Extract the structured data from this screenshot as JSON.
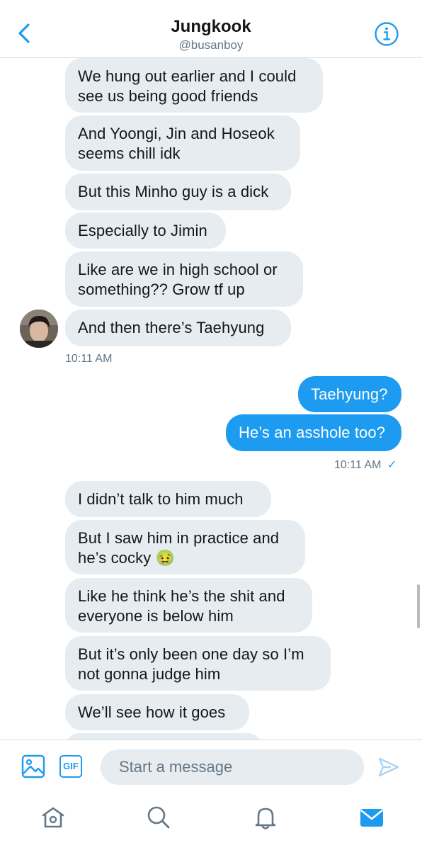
{
  "header": {
    "title": "Jungkook",
    "handle": "@busanboy",
    "back_icon": "chevron-left-icon",
    "info_icon": "info-icon"
  },
  "messages": {
    "group1": [
      {
        "lines": [
          "We hung out earlier and I could",
          "see us being good friends"
        ]
      },
      {
        "lines": [
          "And Yoongi, Jin and Hoseok",
          "seems chill idk"
        ]
      },
      {
        "lines": [
          "But this Minho guy is a dick"
        ]
      },
      {
        "lines": [
          "Especially to Jimin"
        ]
      },
      {
        "lines": [
          "Like are we in high school or",
          "something?? Grow tf up"
        ]
      },
      {
        "lines": [
          "And then there’s Taehyung"
        ]
      }
    ],
    "group1_time": "10:11 AM",
    "group2": [
      {
        "lines": [
          "Taehyung?"
        ]
      },
      {
        "lines": [
          "He’s an asshole too?"
        ]
      }
    ],
    "group2_time": "10:11 AM",
    "group2_status": "✓",
    "group3": [
      {
        "lines": [
          "I didn’t talk to him much"
        ]
      },
      {
        "lines": [
          "But I saw him in practice and",
          "he’s cocky"
        ],
        "emoji": "🤢"
      },
      {
        "lines": [
          "Like he think he’s the shit and",
          "everyone is below him"
        ]
      },
      {
        "lines": [
          "But it’s only been one day so I’m",
          "not gonna judge him"
        ]
      },
      {
        "lines": [
          "We’ll see how it goes"
        ]
      }
    ]
  },
  "composer": {
    "placeholder": "Start a message",
    "gif_label": "GIF",
    "image_icon": "image-icon",
    "send_icon": "send-icon"
  },
  "tabbar": {
    "icons": [
      "home-icon",
      "search-icon",
      "notifications-icon",
      "messages-icon"
    ]
  },
  "colors": {
    "accent": "#1d9bf0",
    "received_bubble": "#e6ecf0",
    "secondary_text": "#657786"
  }
}
